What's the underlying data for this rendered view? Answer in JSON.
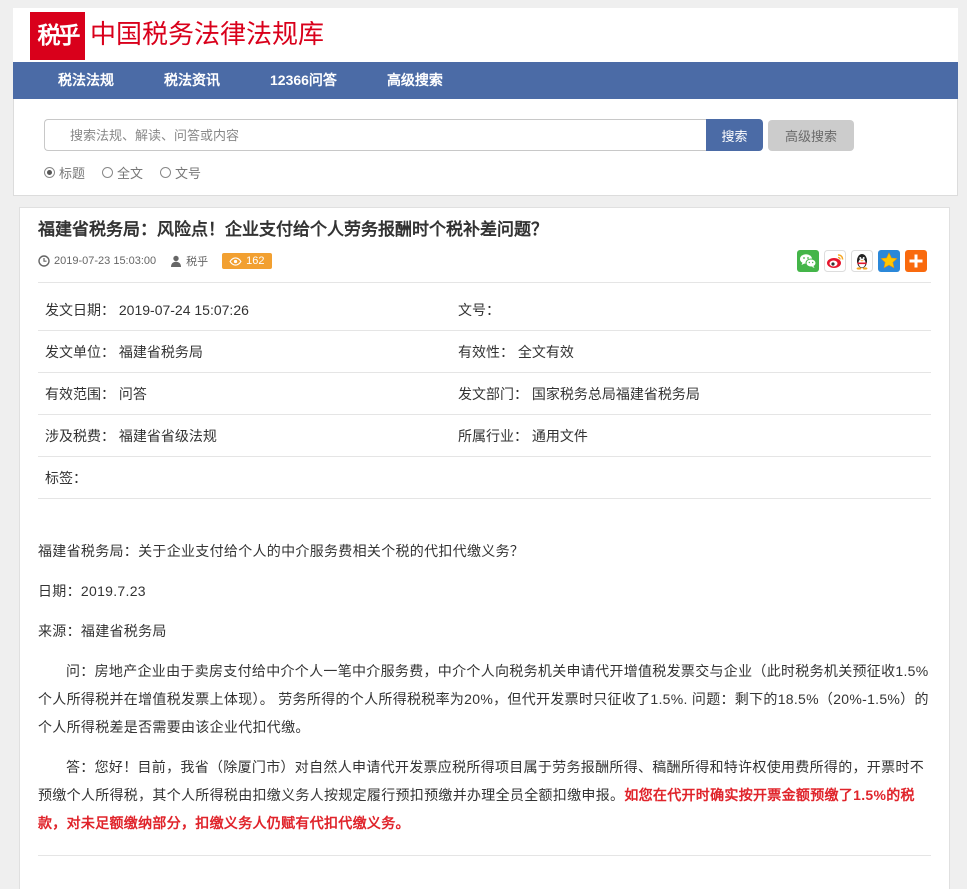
{
  "theme": {
    "page_bg": "#efefef",
    "brand_red": "#d9001b",
    "nav_blue": "#4b6ba6",
    "badge_orange": "#f2a031",
    "highlight_red": "#e0242b"
  },
  "header": {
    "logo_text": "税乎",
    "site_title": "中国税务法律法规库"
  },
  "nav": {
    "items": [
      {
        "label": "税法法规"
      },
      {
        "label": "税法资讯"
      },
      {
        "label": "12366问答"
      },
      {
        "label": "高级搜索"
      }
    ]
  },
  "search": {
    "value": "",
    "placeholder": "搜索法规、解读、问答或内容",
    "submit_label": "搜索",
    "advanced_label": "高级搜索",
    "scopes": [
      {
        "label": "标题",
        "checked": true
      },
      {
        "label": "全文",
        "checked": false
      },
      {
        "label": "文号",
        "checked": false
      }
    ]
  },
  "article": {
    "title": "福建省税务局：风险点！企业支付给个人劳务报酬时个税补差问题？",
    "meta": {
      "published_icon": "clock-icon",
      "published": "2019-07-23 15:03:00",
      "author_icon": "user-icon",
      "author": "税乎",
      "views_icon": "eye-icon",
      "views": "162"
    },
    "share_icons": [
      "wechat-icon",
      "weibo-icon",
      "qq-icon",
      "qzone-icon",
      "more-share-icon"
    ],
    "info": [
      {
        "left": {
          "label": "发文日期：",
          "value": "2019-07-24 15:07:26"
        },
        "right": {
          "label": "文号：",
          "value": ""
        }
      },
      {
        "left": {
          "label": "发文单位：",
          "value": "福建省税务局"
        },
        "right": {
          "label": "有效性：",
          "value": "全文有效"
        }
      },
      {
        "left": {
          "label": "有效范围：",
          "value": "问答"
        },
        "right": {
          "label": "发文部门：",
          "value": "国家税务总局福建省税务局"
        }
      },
      {
        "left": {
          "label": "涉及税费：",
          "value": "福建省省级法规"
        },
        "right": {
          "label": "所属行业：",
          "value": "通用文件"
        }
      },
      {
        "left": {
          "label": "标签：",
          "value": ""
        }
      }
    ],
    "body": {
      "lead": "福建省税务局：关于企业支付给个人的中介服务费相关个税的代扣代缴义务？",
      "date_line": "日期：2019.7.23",
      "source_line": "来源：福建省税务局",
      "question": "问：房地产企业由于卖房支付给中介个人一笔中介服务费，中介个人向税务机关申请代开增值税发票交与企业（此时税务机关预征收1.5%个人所得税并在增值税发票上体现）。 劳务所得的个人所得税税率为20%，但代开发票时只征收了1.5%. 问题：剩下的18.5%（20%-1.5%）的个人所得税差是否需要由该企业代扣代缴。",
      "answer": "答：您好！目前，我省（除厦门市）对自然人申请代开发票应税所得项目属于劳务报酬所得、稿酬所得和特许权使用费所得的，开票时不预缴个人所得税，其个人所得税由扣缴义务人按规定履行预扣预缴并办理全员全额扣缴申报。",
      "answer_highlight": "如您在代开时确实按开票金额预缴了1.5%的税款，对未足额缴纳部分，扣缴义务人仍赋有代扣代缴义务。"
    }
  }
}
